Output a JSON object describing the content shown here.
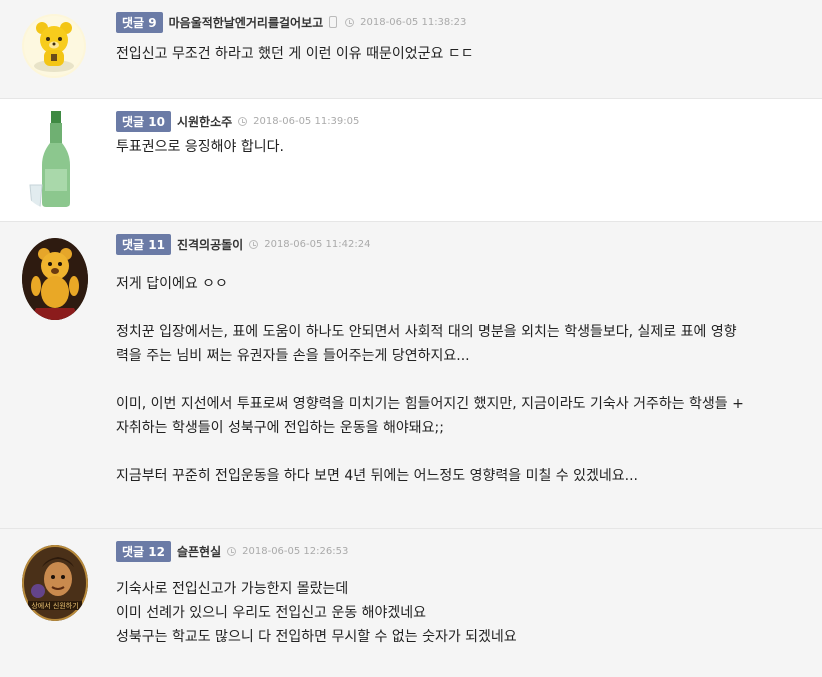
{
  "comments": [
    {
      "label": "댓글 9",
      "author": "마음울적한날엔거리를걸어보고",
      "time": "2018-06-05 11:38:23",
      "mobile": true,
      "avatar": "bear-avatar",
      "lines": [
        "전입신고 무조건 하라고 했던 게 이런 이유 때문이었군요 ㄷㄷ"
      ]
    },
    {
      "label": "댓글 10",
      "author": "시원한소주",
      "time": "2018-06-05 11:39:05",
      "avatar": "soju-bottle-avatar",
      "lines": [
        "투표권으로 응징해야 합니다."
      ]
    },
    {
      "label": "댓글 11",
      "author": "진격의공돌이",
      "time": "2018-06-05 11:42:24",
      "avatar": "bear-figure-avatar",
      "lines": [
        "저게 답이에요 ㅇㅇ",
        "정치꾼 입장에서는, 표에 도움이 하나도 안되면서 사회적 대의 명분을 외치는 학생들보다, 실제로 표에 영향",
        "력을 주는 님비 쩌는 유권자들 손을 들어주는게 당연하지요...",
        "이미, 이번 지선에서 투표로써 영향력을 미치기는 힘들어지긴 했지만, 지금이라도 기숙사 거주하는 학생들 +",
        "자취하는 학생들이 성북구에 전입하는 운동을 해야돼요;;",
        "지금부터 꾸준히 전입운동을 하다 보면 4년 뒤에는 어느정도 영향력을 미칠 수 있겠네요..."
      ]
    },
    {
      "label": "댓글 12",
      "author": "슬픈현실",
      "time": "2018-06-05 12:26:53",
      "avatar": "portrait-avatar",
      "avatar_text": "상에서 신원하기",
      "lines": [
        "기숙사로 전입신고가 가능한지 몰랐는데",
        "이미 선례가 있으니 우리도 전입신고 운동 해야겠네요",
        "성북구는 학교도 많으니 다 전입하면 무시할 수 없는 숫자가 되겠네요"
      ]
    }
  ]
}
